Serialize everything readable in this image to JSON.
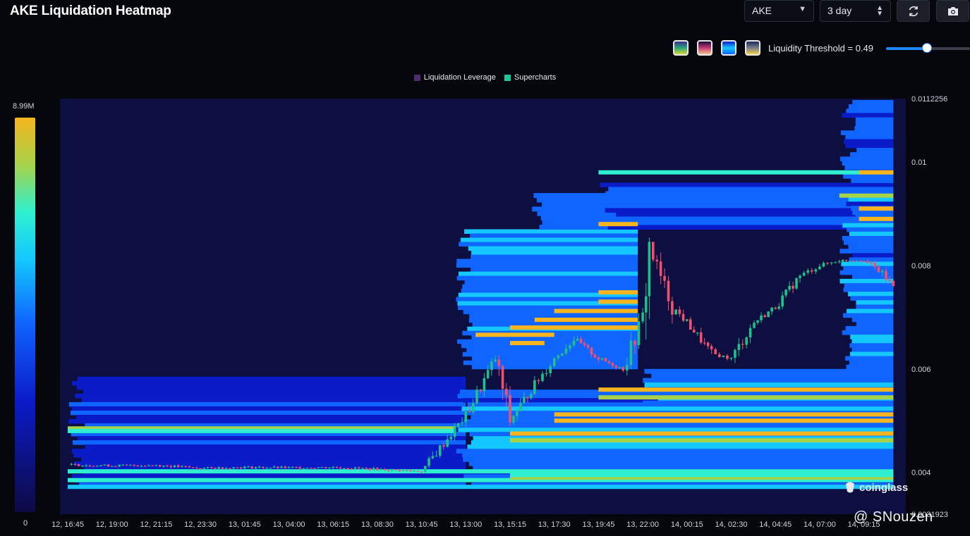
{
  "header": {
    "title": "AKE Liquidation Heatmap",
    "symbol_select": "AKE",
    "range_select": "3 day",
    "refresh_icon": "refresh-icon",
    "screenshot_icon": "camera-icon"
  },
  "controls": {
    "palettes": [
      "viridis-palette-icon",
      "magma-palette-icon",
      "blue-palette-icon",
      "cividis-palette-icon"
    ],
    "threshold_label": "Liquidity Threshold = 0.49",
    "threshold_value": 0.49
  },
  "legend": {
    "items": [
      {
        "label": "Liquidation Leverage",
        "color": "#4a2f6b"
      },
      {
        "label": "Supercharts",
        "color": "#18c79a"
      }
    ]
  },
  "colorbar": {
    "max_label": "8.99M",
    "min_label": "0"
  },
  "watermark": {
    "brand": "coinglass",
    "credit": "@ SNouzen"
  },
  "chart_data": {
    "type": "heatmap",
    "title": "AKE Liquidation Heatmap",
    "x_tick_labels": [
      "12, 16:45",
      "12, 19:00",
      "12, 21:15",
      "12, 23:30",
      "13, 01:45",
      "13, 04:00",
      "13, 06:15",
      "13, 08:30",
      "13, 10:45",
      "13, 13:00",
      "13, 15:15",
      "13, 17:30",
      "13, 19:45",
      "13, 22:00",
      "14, 00:15",
      "14, 02:30",
      "14, 04:45",
      "14, 07:00",
      "14, 09:15"
    ],
    "y_tick_labels": [
      "0.0112256",
      "0.01",
      "0.008",
      "0.006",
      "0.004",
      "0.0031923"
    ],
    "y_range": [
      0.0031923,
      0.0112256
    ],
    "colorscale_range": [
      0,
      8990000
    ],
    "colors": {
      "up": "#1fc08a",
      "down": "#f0506e",
      "scale": [
        "#0e0a45",
        "#0a1bc8",
        "#1064ff",
        "#14c8ff",
        "#2ef0d0",
        "#a6d24a",
        "#f6b41e"
      ]
    },
    "price_anchors": [
      [
        "12, 16:45",
        0.00415
      ],
      [
        "12, 19:00",
        0.00413
      ],
      [
        "12, 21:15",
        0.00414
      ],
      [
        "12, 23:30",
        0.00408
      ],
      [
        "13, 01:45",
        0.0041
      ],
      [
        "13, 04:00",
        0.00409
      ],
      [
        "13, 06:15",
        0.0041
      ],
      [
        "13, 08:30",
        0.00406
      ],
      [
        "13, 10:45",
        0.00402
      ],
      [
        "13, 13:00",
        0.0051
      ],
      [
        "13, 14:30",
        0.0062
      ],
      [
        "13, 15:15",
        0.005
      ],
      [
        "13, 16:30",
        0.0057
      ],
      [
        "13, 17:30",
        0.0062
      ],
      [
        "13, 18:30",
        0.00658
      ],
      [
        "13, 19:45",
        0.0062
      ],
      [
        "13, 21:00",
        0.006
      ],
      [
        "13, 22:00",
        0.007
      ],
      [
        "13, 22:20",
        0.00835
      ],
      [
        "13, 23:30",
        0.0072
      ],
      [
        "14, 00:15",
        0.0069
      ],
      [
        "14, 01:30",
        0.0063
      ],
      [
        "14, 02:30",
        0.0062
      ],
      [
        "14, 03:40",
        0.0069
      ],
      [
        "14, 04:45",
        0.0072
      ],
      [
        "14, 06:00",
        0.0078
      ],
      [
        "14, 07:00",
        0.008
      ],
      [
        "14, 08:00",
        0.0081
      ],
      [
        "14, 09:15",
        0.0081
      ],
      [
        "14, 10:00",
        0.0079
      ],
      [
        "14, 10:45",
        0.0076
      ]
    ],
    "liquidation_bands": [
      {
        "price": 0.00485,
        "start": "12, 16:45",
        "end": "13, 12:30",
        "intensity": 0.85
      },
      {
        "price": 0.0048,
        "start": "12, 16:45",
        "end": "13, 12:30",
        "intensity": 0.7
      },
      {
        "price": 0.00402,
        "start": "12, 16:45",
        "end": "14, 10:45",
        "intensity": 0.6
      },
      {
        "price": 0.00385,
        "start": "12, 16:45",
        "end": "14, 10:45",
        "intensity": 0.65
      },
      {
        "price": 0.00372,
        "start": "12, 16:45",
        "end": "14, 10:45",
        "intensity": 0.55
      },
      {
        "price": 0.0039,
        "start": "13, 15:15",
        "end": "14, 10:45",
        "intensity": 0.8
      },
      {
        "price": 0.00395,
        "start": "13, 15:15",
        "end": "14, 10:45",
        "intensity": 0.7
      },
      {
        "price": 0.0056,
        "start": "13, 19:45",
        "end": "14, 10:45",
        "intensity": 1.0
      },
      {
        "price": 0.00545,
        "start": "13, 19:45",
        "end": "14, 10:45",
        "intensity": 0.75
      },
      {
        "price": 0.00512,
        "start": "13, 17:30",
        "end": "14, 10:45",
        "intensity": 1.0
      },
      {
        "price": 0.005,
        "start": "13, 17:30",
        "end": "14, 10:45",
        "intensity": 0.95
      },
      {
        "price": 0.00475,
        "start": "13, 15:15",
        "end": "14, 10:45",
        "intensity": 1.0
      },
      {
        "price": 0.00462,
        "start": "13, 15:15",
        "end": "14, 10:45",
        "intensity": 0.8
      },
      {
        "price": 0.0088,
        "start": "13, 19:45",
        "end": "13, 21:45",
        "intensity": 1.0
      },
      {
        "price": 0.00748,
        "start": "13, 19:45",
        "end": "13, 21:45",
        "intensity": 1.0
      },
      {
        "price": 0.0073,
        "start": "13, 19:45",
        "end": "13, 21:45",
        "intensity": 1.0
      },
      {
        "price": 0.00712,
        "start": "13, 17:30",
        "end": "13, 21:45",
        "intensity": 1.0
      },
      {
        "price": 0.00695,
        "start": "13, 16:30",
        "end": "13, 21:45",
        "intensity": 1.0
      },
      {
        "price": 0.0068,
        "start": "13, 15:15",
        "end": "13, 21:45",
        "intensity": 1.0
      },
      {
        "price": 0.00666,
        "start": "13, 13:30",
        "end": "13, 17:30",
        "intensity": 1.0
      },
      {
        "price": 0.0065,
        "start": "13, 15:15",
        "end": "13, 17:00",
        "intensity": 1.0
      },
      {
        "price": 0.0098,
        "start": "13, 19:45",
        "end": "14, 10:45",
        "intensity": 0.7
      },
      {
        "price": 0.0098,
        "start": "14, 09:00",
        "end": "14, 10:45",
        "intensity": 1.0
      },
      {
        "price": 0.00935,
        "start": "14, 08:00",
        "end": "14, 10:45",
        "intensity": 0.85
      },
      {
        "price": 0.0091,
        "start": "14, 09:00",
        "end": "14, 10:45",
        "intensity": 1.0
      },
      {
        "price": 0.0089,
        "start": "14, 09:00",
        "end": "14, 10:45",
        "intensity": 1.0
      }
    ]
  }
}
